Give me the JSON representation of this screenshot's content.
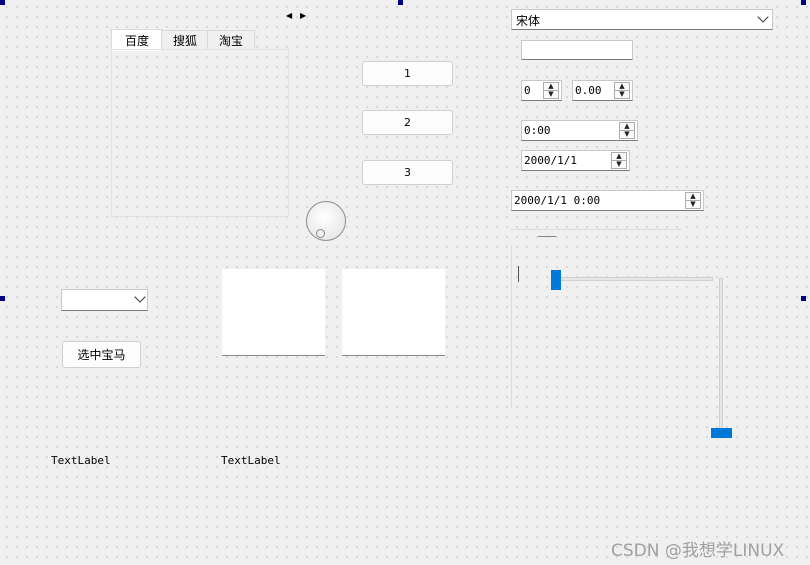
{
  "tabs": [
    {
      "label": "百度"
    },
    {
      "label": "搜狐"
    },
    {
      "label": "淘宝"
    }
  ],
  "buttons": {
    "one": "1",
    "two": "2",
    "three": "3",
    "select_bmw": "选中宝马"
  },
  "font_combo": {
    "value": "宋体"
  },
  "spin_int": {
    "value": "0"
  },
  "spin_double": {
    "value": "0.00"
  },
  "time_edit": {
    "value": "0:00"
  },
  "date_edit": {
    "value": "2000/1/1"
  },
  "datetime_edit": {
    "value": "2000/1/1 0:00"
  },
  "labels": {
    "label1": "TextLabel",
    "label2": "TextLabel"
  },
  "sliders": {
    "horizontal_value": 0,
    "vertical_value": 0
  },
  "watermark": "CSDN @我想学LINUX",
  "colors": {
    "accent": "#0078d7",
    "handle": "#000080"
  }
}
